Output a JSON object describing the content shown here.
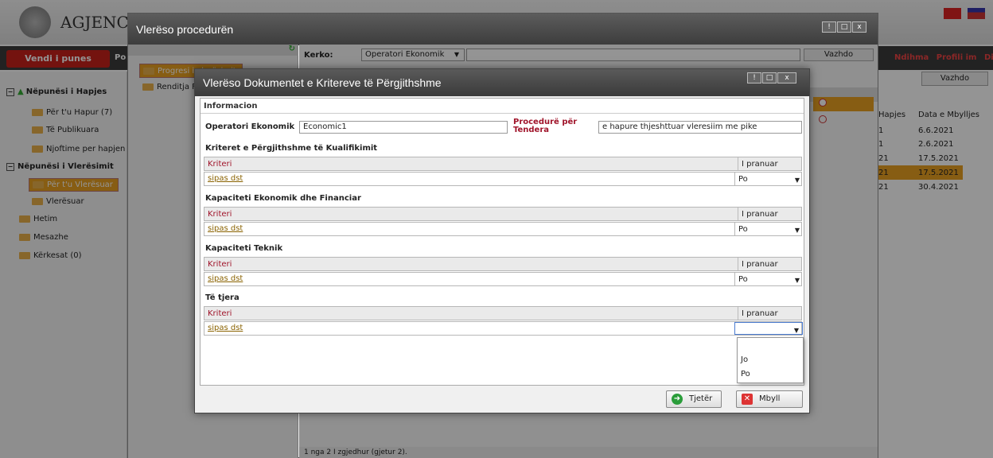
{
  "app": {
    "brand": "AGJENCIA",
    "menu_vendi": "Vendi i punes",
    "menu_po": "Po",
    "right_menu": [
      "Ndihma",
      "Profili im",
      "Di"
    ],
    "vazhdo_right": "Vazhdo"
  },
  "sidebar": {
    "group1": "Nëpunësi i Hapjes",
    "items1": [
      "Për t'u Hapur (7)",
      "Të Publikuara",
      "Njoftime per hapjen e"
    ],
    "group2": "Nëpunësi i Vlerësimit",
    "items2": [
      "Për t'u Vlerësuar",
      "Vlerësuar"
    ],
    "other": [
      "Hetim",
      "Mesazhe",
      "Kërkesat (0)"
    ]
  },
  "outer_dialog": {
    "title": "Vlerëso procedurën",
    "nav": [
      "Progresi i vlerësimit",
      "Renditja F"
    ],
    "search_label": "Kerko:",
    "search_select": "Operatori Ekonomik",
    "search_button": "Vazhdo",
    "footer": "1 nga 2 I zgjedhur (gjetur 2)."
  },
  "grid": {
    "col_hapjes": "Hapjes",
    "col_mbylljes": "Data e Mbylljes",
    "rows": [
      {
        "hapjes": "1",
        "mbylljes": "6.6.2021"
      },
      {
        "hapjes": "1",
        "mbylljes": "2.6.2021"
      },
      {
        "hapjes": "21",
        "mbylljes": "17.5.2021"
      },
      {
        "hapjes": "21",
        "mbylljes": "17.5.2021"
      },
      {
        "hapjes": "21",
        "mbylljes": "30.4.2021"
      }
    ]
  },
  "dialog": {
    "title": "Vlerëso Dokumentet e Kritereve të Përgjithshme",
    "section": "Informacion",
    "operator_label": "Operatori Ekonomik",
    "operator_value": "Economic1",
    "procedure_label": "Procedurë për Tendera",
    "procedure_value": "e hapure thjeshttuar vleresiim me pike",
    "col_kriteri": "Kriteri",
    "col_pranuar": "I pranuar",
    "groups": [
      {
        "title": "Kriteret e Përgjithshme të Kualifikimit",
        "link": "sipas dst",
        "value": "Po"
      },
      {
        "title": "Kapaciteti Ekonomik dhe Financiar",
        "link": "sipas dst",
        "value": "Po"
      },
      {
        "title": "Kapaciteti Teknik",
        "link": "sipas dst",
        "value": "Po"
      },
      {
        "title": "Të tjera",
        "link": "sipas dst",
        "value": ""
      }
    ],
    "dropdown_options": [
      "Jo",
      "Po"
    ],
    "btn_next": "Tjetër",
    "btn_close": "Mbyll"
  },
  "colors": {
    "accent": "#c8201a",
    "highlight": "#e8a020",
    "title_bar": "#4a4a4a",
    "label_red": "#a0142a"
  }
}
